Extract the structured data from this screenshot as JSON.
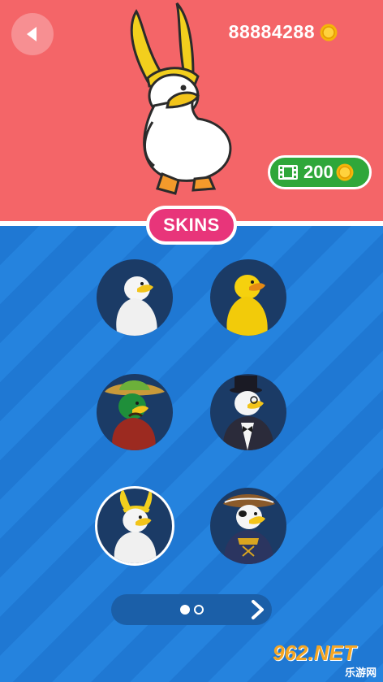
{
  "header": {
    "coins": "88884288",
    "coin_icon": "gold-coin-icon",
    "back_icon": "back-arrow-icon"
  },
  "preview": {
    "character": "white duck with golden horned helmet"
  },
  "reward_button": {
    "icon": "video-ad-icon",
    "price": "200"
  },
  "title": "SKINS",
  "skins": [
    {
      "name": "white duck",
      "selected": false
    },
    {
      "name": "yellow duck",
      "selected": false
    },
    {
      "name": "green mallard with sombrero",
      "selected": false
    },
    {
      "name": "gentleman duck with top hat",
      "selected": false
    },
    {
      "name": "white duck with horned helmet",
      "selected": true
    },
    {
      "name": "pirate duck",
      "selected": false
    }
  ],
  "pager": {
    "pages": 2,
    "current": 1,
    "next_icon": "chevron-right-icon"
  },
  "watermark": {
    "main": "962.NET",
    "sub": "乐游网"
  },
  "colors": {
    "top_bg": "#f46568",
    "bottom_bg": "#1f78d3",
    "pill": "#e8357a",
    "reward_green": "#2fa73a",
    "coin_gold": "#f5b50a"
  }
}
